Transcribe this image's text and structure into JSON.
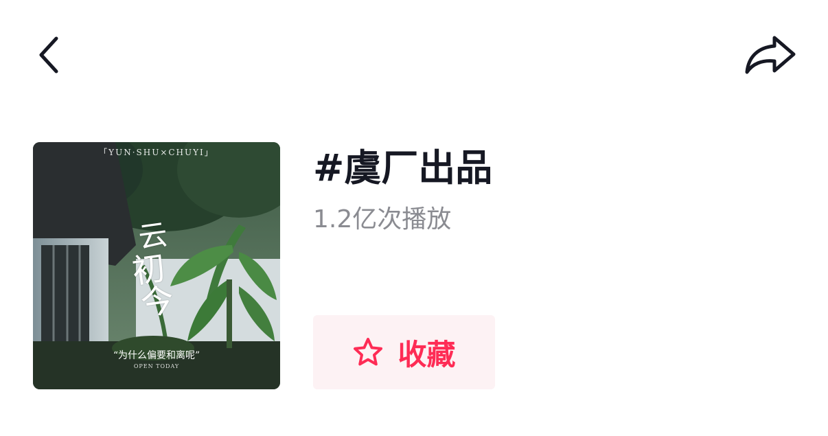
{
  "header": {
    "back_icon": "chevron-left-icon",
    "share_icon": "share-arrow-icon"
  },
  "cover": {
    "top_text": "「YUN·SHU×CHUYI」",
    "calligraphy": [
      "云",
      "初",
      "今"
    ],
    "quote": "“为什么偏要和离呢”",
    "open_text": "OPEN TODAY"
  },
  "topic": {
    "title": "#虞厂出品",
    "plays": "1.2亿次播放"
  },
  "favorite": {
    "label": "收藏",
    "icon": "star-outline-icon",
    "accent_color": "#fe2c55",
    "background_color": "#fdf2f4"
  }
}
